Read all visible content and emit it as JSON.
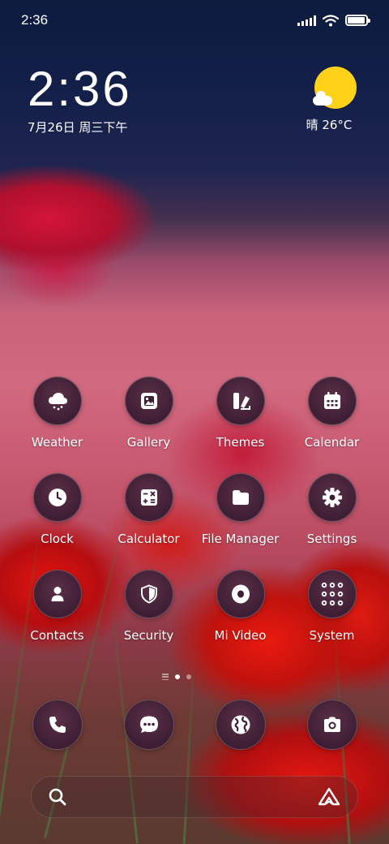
{
  "status_bar": {
    "time": "2:36",
    "signal_icon": "signal-icon",
    "wifi_icon": "wifi-icon",
    "battery_icon": "battery-icon",
    "battery_level": 0.95
  },
  "clock_widget": {
    "time": "2:36",
    "date": "7月26日 周三下午"
  },
  "weather_widget": {
    "icon": "sun-cloud-icon",
    "text": "晴 26°C"
  },
  "apps": [
    {
      "label": "Weather",
      "icon": "weather-cloud-icon"
    },
    {
      "label": "Gallery",
      "icon": "gallery-icon"
    },
    {
      "label": "Themes",
      "icon": "themes-icon"
    },
    {
      "label": "Calendar",
      "icon": "calendar-icon"
    },
    {
      "label": "Clock",
      "icon": "clock-icon"
    },
    {
      "label": "Calculator",
      "icon": "calculator-icon"
    },
    {
      "label": "File Manager",
      "icon": "folder-icon"
    },
    {
      "label": "Settings",
      "icon": "gear-icon"
    },
    {
      "label": "Contacts",
      "icon": "person-icon"
    },
    {
      "label": "Security",
      "icon": "shield-icon"
    },
    {
      "label": "Mi Video",
      "icon": "video-icon"
    },
    {
      "label": "System",
      "icon": "folder-grid-icon"
    }
  ],
  "page_indicator": {
    "pages": 2,
    "current": 1
  },
  "dock": [
    {
      "icon": "phone-icon"
    },
    {
      "icon": "message-icon"
    },
    {
      "icon": "browser-globe-icon"
    },
    {
      "icon": "camera-icon"
    }
  ],
  "search_bar": {
    "search_icon": "search-icon",
    "assistant_icon": "assistant-icon"
  },
  "colors": {
    "icon_bg": "#3e1e34",
    "sun": "#ffd21a",
    "sky_top": "#0c1b3e",
    "poppy_red": "#e4150f"
  }
}
